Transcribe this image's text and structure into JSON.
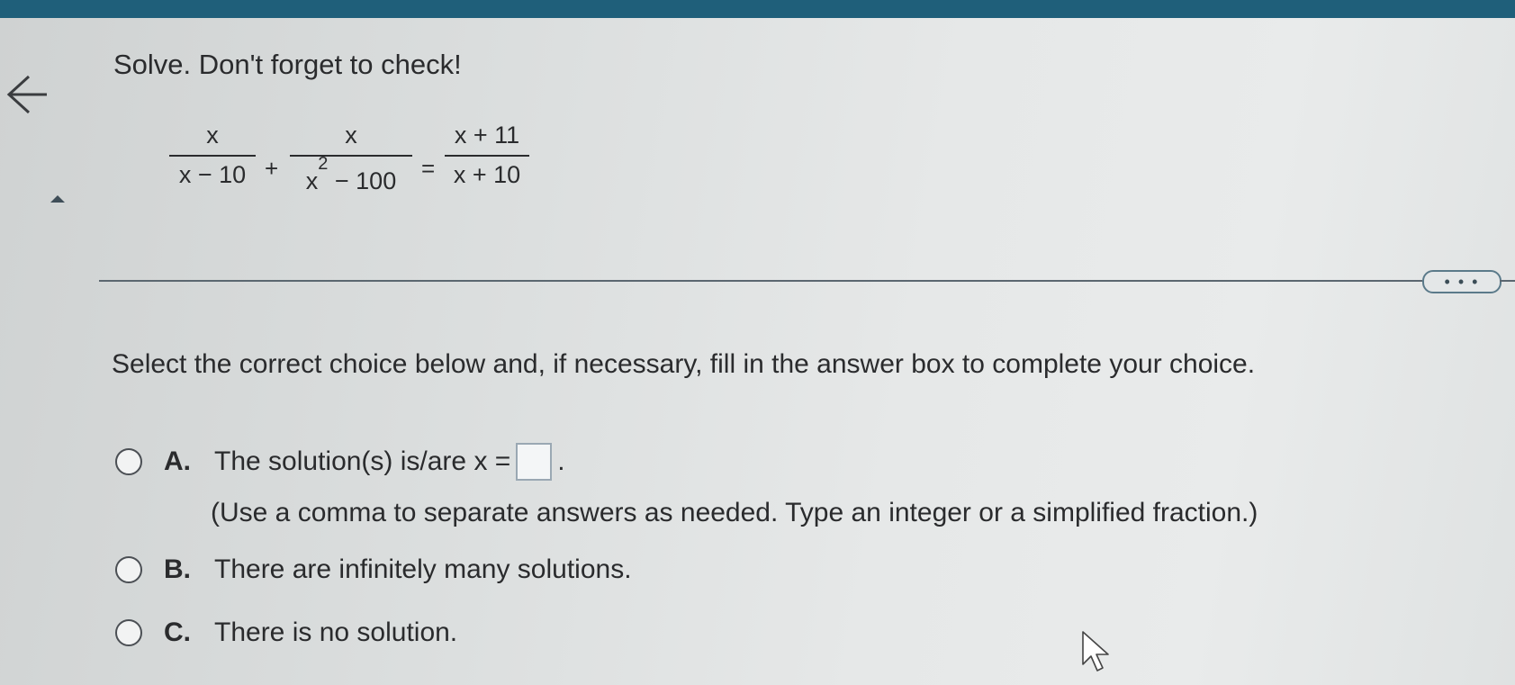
{
  "header": {
    "accent_color": "#1f5f7a"
  },
  "nav": {
    "back_icon": "arrow-left-icon"
  },
  "question": {
    "title": "Solve. Don't forget to check!",
    "equation": {
      "f1_num": "x",
      "f1_den": "x − 10",
      "op1": "+",
      "f2_num": "x",
      "f2_den_base": "x",
      "f2_den_exp": "2",
      "f2_den_rest": " − 100",
      "op2": "=",
      "f3_num": "x + 11",
      "f3_den": "x + 10"
    }
  },
  "more_button": {
    "label": "• • •"
  },
  "instructions": "Select the correct choice below and, if necessary, fill in the answer box to complete your choice.",
  "choices": [
    {
      "letter": "A.",
      "text_before": "The solution(s) is/are x =",
      "text_after": ".",
      "hint": "(Use a comma to separate answers as needed. Type an integer or a simplified fraction.)",
      "answer_value": ""
    },
    {
      "letter": "B.",
      "text": "There are infinitely many solutions."
    },
    {
      "letter": "C.",
      "text": "There is no solution."
    }
  ]
}
